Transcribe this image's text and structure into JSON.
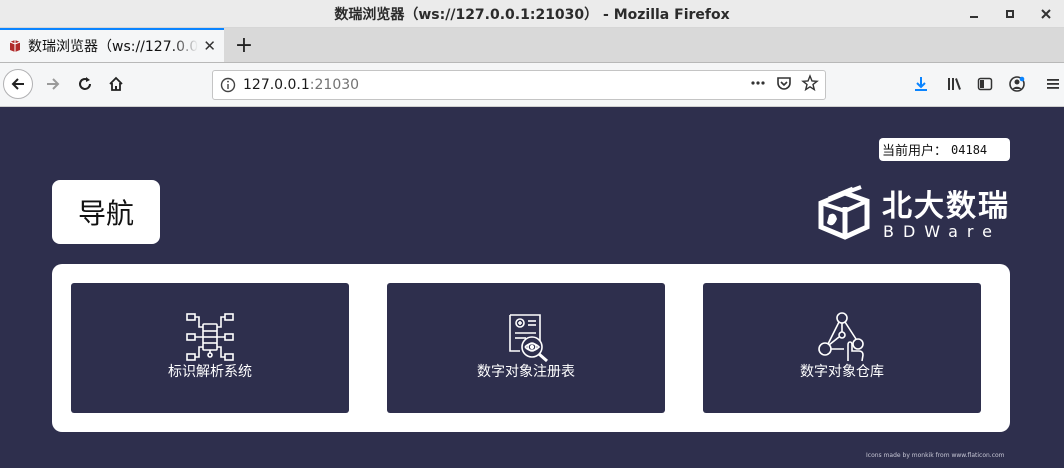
{
  "window": {
    "title": "数瑞浏览器（ws://127.0.0.1:21030） - Mozilla Firefox",
    "controls": [
      "minimize-icon",
      "maximize-icon",
      "close-icon"
    ]
  },
  "tabs": [
    {
      "label": "数瑞浏览器（ws://127.0.0.1:21030）",
      "active": true
    }
  ],
  "navbar": {
    "url_host": "127.0.0.1",
    "url_port": ":21030",
    "icons": [
      "back-icon",
      "forward-icon",
      "reload-icon",
      "home-icon",
      "page-actions-icon",
      "pocket-icon",
      "bookmark-star-icon",
      "download-icon",
      "library-icon",
      "sidebar-icon",
      "account-icon",
      "menu-icon"
    ]
  },
  "page": {
    "user_label": "当前用户：",
    "user_value": "04184",
    "nav_title": "导航",
    "logo": {
      "cn": "北大数瑞",
      "en": "BDWare"
    },
    "cards": [
      {
        "label": "标识解析系统",
        "icon": "network-tree-icon"
      },
      {
        "label": "数字对象注册表",
        "icon": "document-search-icon"
      },
      {
        "label": "数字对象仓库",
        "icon": "molecule-hand-icon"
      }
    ],
    "credit": "Icons made by monkik from www.flaticon.com"
  },
  "colors": {
    "page_bg": "#2e2f4d",
    "card_bg": "#2e2f4d",
    "panel_bg": "#ffffff",
    "tab_accent": "#0a84ff",
    "download_icon": "#0a84ff"
  }
}
